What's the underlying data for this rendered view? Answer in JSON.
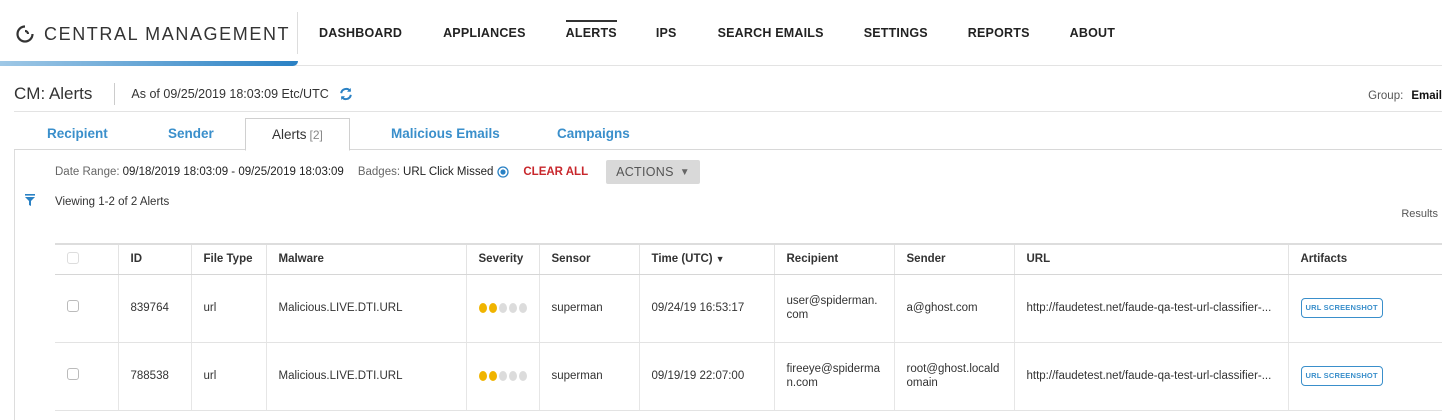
{
  "app": {
    "brand": "CENTRAL MANAGEMENT",
    "accent_color": "#2a81c4"
  },
  "nav": {
    "items": [
      {
        "label": "DASHBOARD",
        "active": false
      },
      {
        "label": "APPLIANCES",
        "active": false
      },
      {
        "label": "ALERTS",
        "active": true
      },
      {
        "label": "IPS",
        "active": false
      },
      {
        "label": "SEARCH EMAILS",
        "active": false
      },
      {
        "label": "SETTINGS",
        "active": false
      },
      {
        "label": "REPORTS",
        "active": false
      },
      {
        "label": "ABOUT",
        "active": false
      }
    ]
  },
  "header": {
    "title": "CM: Alerts",
    "as_of": "As of 09/25/2019 18:03:09 Etc/UTC",
    "group_label": "Group:",
    "group_value": "Email"
  },
  "tabs": [
    {
      "label": "Recipient",
      "count": ""
    },
    {
      "label": "Sender",
      "count": ""
    },
    {
      "label": "Alerts",
      "count": "[2]",
      "active": true
    },
    {
      "label": "Malicious Emails",
      "count": ""
    },
    {
      "label": "Campaigns",
      "count": ""
    }
  ],
  "filters": {
    "date_range_label": "Date Range:",
    "date_range_value": "09/18/2019 18:03:09 - 09/25/2019 18:03:09",
    "badges_label": "Badges:",
    "badges_value": "URL Click Missed",
    "clear_all": "CLEAR ALL",
    "actions": "ACTIONS"
  },
  "viewing": "Viewing 1-2 of 2 Alerts",
  "results": "Results",
  "table": {
    "columns": [
      "",
      "ID",
      "File Type",
      "Malware",
      "Severity",
      "Sensor",
      "Time (UTC)",
      "Recipient",
      "Sender",
      "URL",
      "Artifacts"
    ],
    "rows": [
      {
        "id": "839764",
        "file_type": "url",
        "malware": "Malicious.LIVE.DTI.URL",
        "severity": 2,
        "severity_max": 5,
        "sensor": "superman",
        "time": "09/24/19 16:53:17",
        "recipient": "user@spiderman.com",
        "sender": "a@ghost.com",
        "url": "http://faudetest.net/faude-qa-test-url-classifier-...",
        "artifact": "URL SCREENSHOT"
      },
      {
        "id": "788538",
        "file_type": "url",
        "malware": "Malicious.LIVE.DTI.URL",
        "severity": 2,
        "severity_max": 5,
        "sensor": "superman",
        "time": "09/19/19 22:07:00",
        "recipient": "fireeye@spiderman.com",
        "sender": "root@ghost.localdomain",
        "url": "http://faudetest.net/faude-qa-test-url-classifier-...",
        "artifact": "URL SCREENSHOT"
      }
    ]
  }
}
